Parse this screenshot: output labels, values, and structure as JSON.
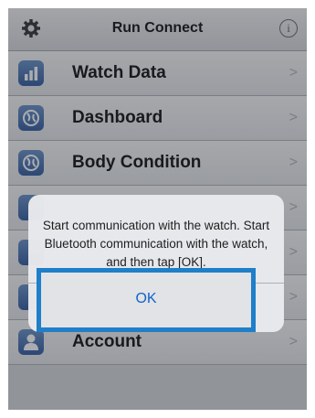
{
  "header": {
    "title": "Run Connect",
    "settings_icon": "gear-icon",
    "info_icon": "info-icon",
    "info_glyph": "i"
  },
  "menu": {
    "items": [
      {
        "label": "Watch Data",
        "icon": "bar-chart-icon"
      },
      {
        "label": "Dashboard",
        "icon": "globe-icon"
      },
      {
        "label": "Body Condition",
        "icon": "globe-icon"
      },
      {
        "label": "",
        "icon": "app-icon"
      },
      {
        "label": "",
        "icon": "app-icon"
      },
      {
        "label": "",
        "icon": "app-icon"
      },
      {
        "label": "Account",
        "icon": "person-icon"
      }
    ],
    "chevron": ">"
  },
  "dialog": {
    "message": "Start communication with the watch. Start Bluetooth communication with the watch, and then tap [OK].",
    "ok_label": "OK",
    "highlight_color": "#1f7fc8"
  }
}
